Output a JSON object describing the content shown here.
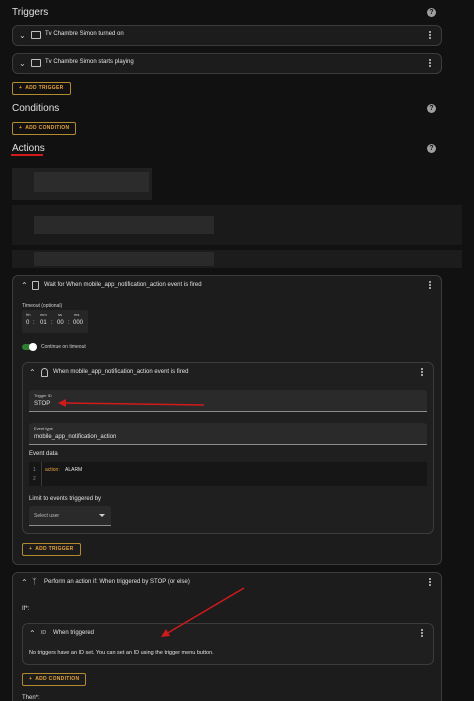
{
  "sections": {
    "triggers": "Triggers",
    "conditions": "Conditions",
    "actions": "Actions",
    "help": "?"
  },
  "triggers": [
    {
      "label": "Tv Chambre Simon turned on"
    },
    {
      "label": "Tv Chambre Simon starts playing"
    }
  ],
  "buttons": {
    "add_trigger": "ADD TRIGGER",
    "add_condition": "ADD CONDITION",
    "plus": "+"
  },
  "wait_action": {
    "title": "Wait for When mobile_app_notification_action event is fired",
    "timeout_label": "Timeout (optional)",
    "timeout_units": {
      "h": "hh",
      "m": "mm",
      "s": "ss",
      "ms": "ms"
    },
    "timeout_values": {
      "h": "0",
      "m": "01",
      "s": "00",
      "ms": "000"
    },
    "sep": ":",
    "continue_label": "Continue on timeout",
    "continue_on": true,
    "inner": {
      "title": "When mobile_app_notification_action event is fired",
      "trigger_id_label": "Trigger ID",
      "trigger_id_value": "STOP",
      "event_type_label": "Event type",
      "event_type_value": "mobile_app_notification_action",
      "event_data_label": "Event data",
      "code_line1_num": "1",
      "code_line2_num": "2",
      "code_key": "action:",
      "code_val": "ALARM",
      "limit_label": "Limit to events triggered by",
      "select_user": "Select user"
    }
  },
  "perform_action": {
    "title": "Perform an action if: When triggered by STOP (or else)",
    "if_label": "If*:",
    "inner_title": "When triggered",
    "inner_icon_label": "ID",
    "inner_msg": "No triggers have an ID set. You can set an ID using the trigger menu button.",
    "then_label": "Then*:"
  },
  "colors": {
    "accent": "#e8a33a",
    "toggle_on": "#2e7d32",
    "annotation_red": "#d11a1a"
  }
}
